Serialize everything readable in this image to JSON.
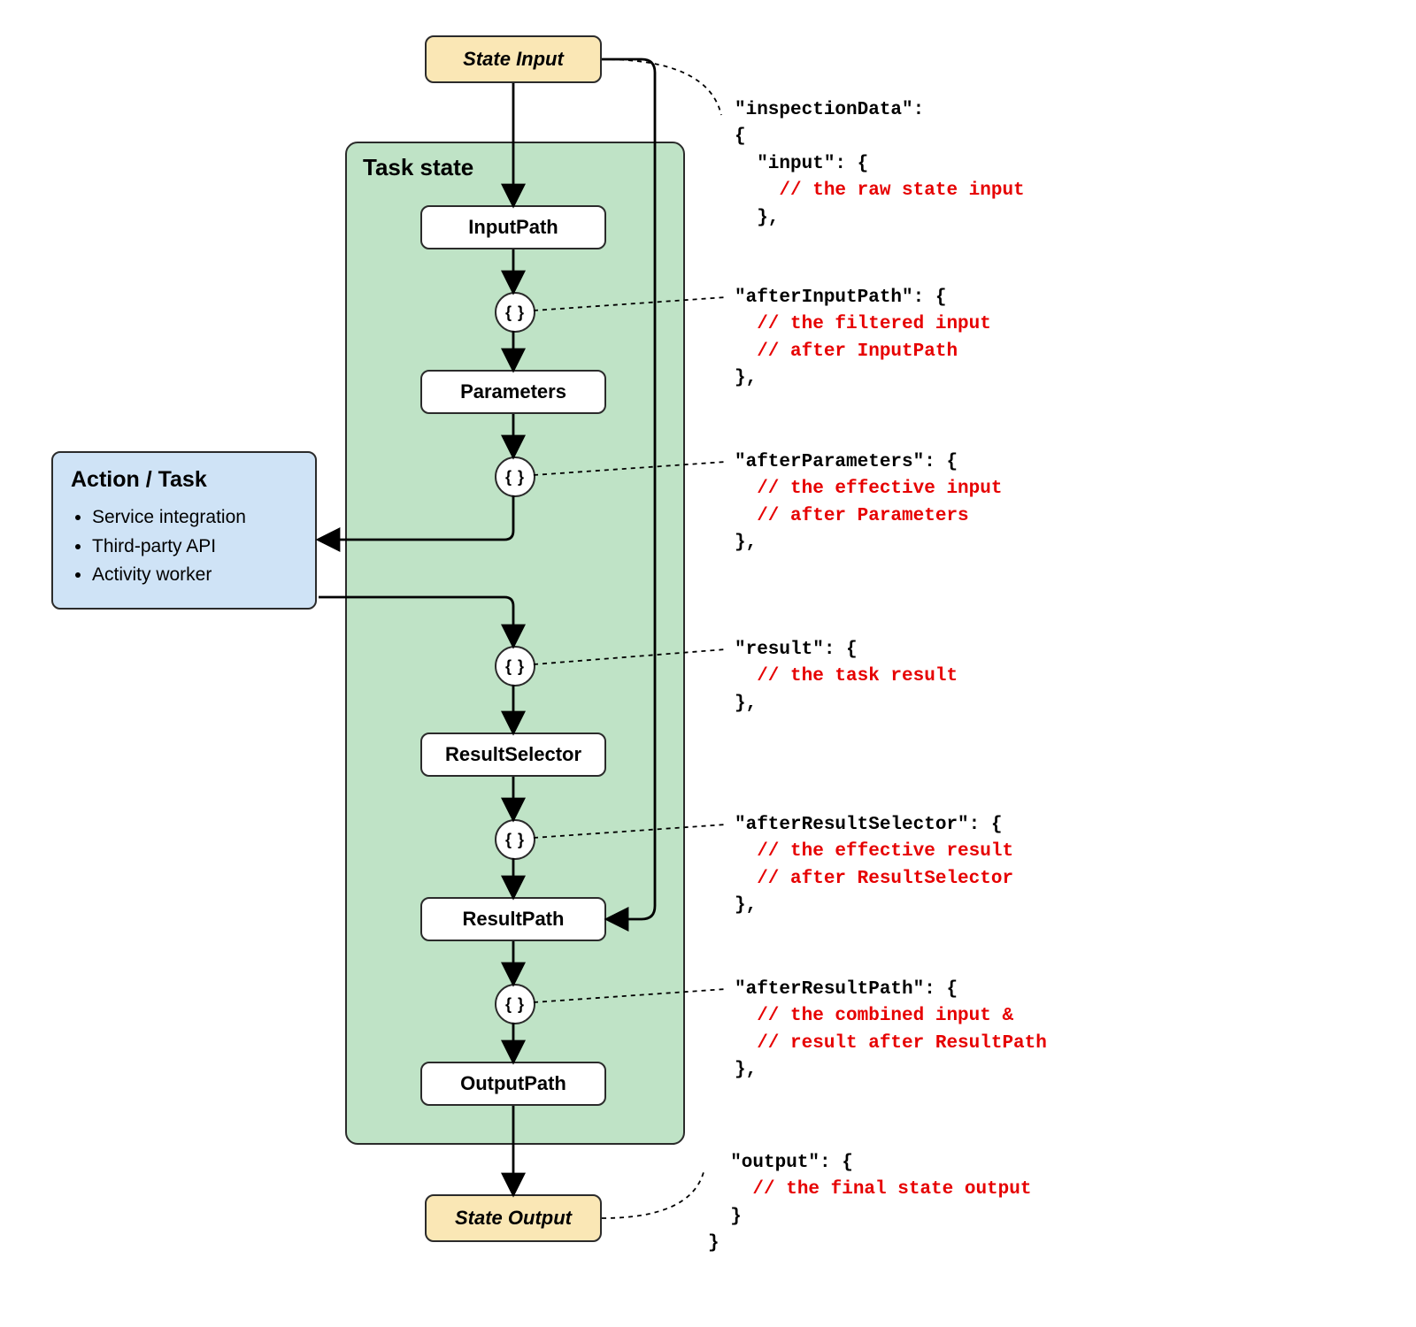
{
  "stateInput": "State Input",
  "stateOutput": "State Output",
  "taskStateTitle": "Task state",
  "stages": {
    "inputPath": "InputPath",
    "parameters": "Parameters",
    "resultSelector": "ResultSelector",
    "resultPath": "ResultPath",
    "outputPath": "OutputPath"
  },
  "braceSymbol": "{ }",
  "action": {
    "title": "Action / Task",
    "items": [
      "Service integration",
      "Third-party API",
      "Activity worker"
    ]
  },
  "code": {
    "header": [
      "\"inspectionData\":",
      "{"
    ],
    "input": {
      "k": "  \"input\": {",
      "c": "    // the raw state input",
      "e": "  },"
    },
    "afterInputPath": {
      "k": "\"afterInputPath\": {",
      "c1": "  // the filtered input",
      "c2": "  // after InputPath",
      "e": "},"
    },
    "afterParameters": {
      "k": "\"afterParameters\": {",
      "c1": "  // the effective input",
      "c2": "  // after Parameters",
      "e": "},"
    },
    "result": {
      "k": "\"result\": {",
      "c": "  // the task result",
      "e": "},"
    },
    "afterResultSelector": {
      "k": "\"afterResultSelector\": {",
      "c1": "  // the effective result",
      "c2": "  // after ResultSelector",
      "e": "},"
    },
    "afterResultPath": {
      "k": "\"afterResultPath\": {",
      "c1": "  // the combined input &",
      "c2": "  // result after ResultPath",
      "e": "},"
    },
    "output": {
      "k": "  \"output\": {",
      "c": "    // the final state output",
      "e": "  }",
      "close": "}"
    }
  }
}
